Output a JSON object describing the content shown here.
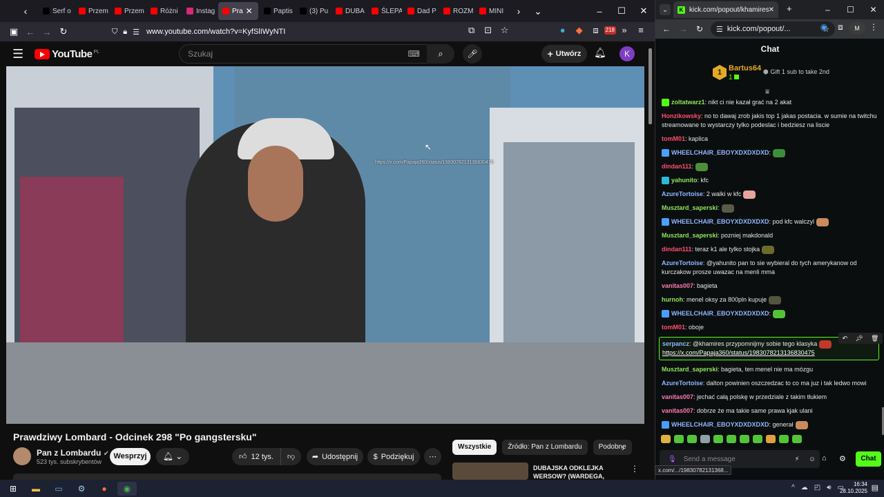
{
  "left_browser": {
    "tabs": [
      {
        "label": "Serf o",
        "color": "#000000",
        "icon": "x-logo-icon"
      },
      {
        "label": "Przem",
        "color": "#ff0000",
        "icon": "youtube-icon"
      },
      {
        "label": "Przem",
        "color": "#ff0000",
        "icon": "youtube-icon"
      },
      {
        "label": "Różni",
        "color": "#ff0000",
        "icon": "youtube-icon"
      },
      {
        "label": "Instag",
        "color": "#d62976",
        "icon": "instagram-icon"
      },
      {
        "label": "Pra",
        "color": "#ff0000",
        "icon": "speaker-icon",
        "active": true
      },
      {
        "label": "Paptis",
        "color": "#000000",
        "icon": "x-logo-icon"
      },
      {
        "label": "(3) Pu",
        "color": "#000000",
        "icon": "x-logo-icon"
      },
      {
        "label": "DUBA",
        "color": "#ff0000",
        "icon": "youtube-icon"
      },
      {
        "label": "ŚLEPA",
        "color": "#ff0000",
        "icon": "youtube-icon"
      },
      {
        "label": "Dad P",
        "color": "#ff0000",
        "icon": "youtube-icon"
      },
      {
        "label": "ROZM",
        "color": "#ff0000",
        "icon": "youtube-icon"
      },
      {
        "label": "MINI",
        "color": "#ff0000",
        "icon": "youtube-icon"
      }
    ],
    "url": "www.youtube.com/watch?v=KyfSlIWyNTI",
    "badge_count": "218"
  },
  "youtube": {
    "logo": "YouTube",
    "logo_region": "PL",
    "search_placeholder": "Szukaj",
    "create_label": "Utwórz",
    "avatar_letter": "K",
    "video_overlay_text": "https://x.com/Papaja360/status/1983078213136830475",
    "title": "Prawdziwy Lombard - Odcinek 298 \"Po gangstersku\"",
    "channel_name": "Pan z Lombardu",
    "subscribers": "523 tys. subskrybentów",
    "support_label": "Wesprzyj",
    "likes": "12 tys.",
    "share_label": "Udostępnij",
    "thanks_label": "Podziękuj",
    "chips": [
      "Wszystkie",
      "Źródło: Pan z Lombardu",
      "Podobne"
    ],
    "rec_title": "DUBAJSKA ODKLEJKA WERSOW? (WARDEGA, NITRO..."
  },
  "right_browser": {
    "tab_title": "kick.com/popout/khamires/cha",
    "url": "kick.com/popout/...",
    "profile_letter": "M"
  },
  "chat": {
    "header": "Chat",
    "pinned_user": "Bartus64",
    "pinned_count": "1",
    "pinned_rank": "1",
    "pinned_gift": "Gift 1 sub to take 2nd",
    "messages": [
      {
        "user": "zoltatwarz1",
        "color": "#8ee65c",
        "text": ": nikt ci nie kazał grać na 2 akat",
        "badge": "#53fc18"
      },
      {
        "user": "Honzikowsky",
        "color": "#ff4d6d",
        "text": ": no to dawaj zrob jakis top 1 jakas postacia. w sumie na twitchu streamowane to wystarczy tylko podeslac i bedziesz na liscie"
      },
      {
        "user": "tomM01",
        "color": "#ff4d6d",
        "text": ": kaplica"
      },
      {
        "user": "WHEELCHAIR_EBOYXDXDXDXD",
        "color": "#8fb8ff",
        "text": ":",
        "badge": "#4a9eff",
        "emote": "#3b8f3b"
      },
      {
        "user": "dindan111",
        "color": "#ff4d6d",
        "text": ":",
        "emote": "#4e8f3a"
      },
      {
        "user": "yahunito",
        "color": "#8ee65c",
        "text": ": kfc",
        "badge": "#2fb9d6"
      },
      {
        "user": "AzureTortoise",
        "color": "#8fb8ff",
        "text": ": 2 walki w kfc",
        "emote": "#e6a59c"
      },
      {
        "user": "Musztard_saperski",
        "color": "#8ee65c",
        "text": ":",
        "emote": "#5a5a48"
      },
      {
        "user": "WHEELCHAIR_EBOYXDXDXDXD",
        "color": "#8fb8ff",
        "text": ": pod kfc walczyl",
        "badge": "#4a9eff",
        "emote": "#c98a5c"
      },
      {
        "user": "Musztard_saperski",
        "color": "#8ee65c",
        "text": ": pozniej makdonald"
      },
      {
        "user": "dindan111",
        "color": "#ff4d6d",
        "text": ": teraz k1 ale tylko stojka",
        "emote": "#6b6b2a"
      },
      {
        "user": "AzureTortoise",
        "color": "#8fb8ff",
        "text": ": @yahunito pan to sie wybieral do tych amerykanow od kurczakow prosze uwazac na menli mma"
      },
      {
        "user": "vanitas007",
        "color": "#ff79b0",
        "text": ": bagieta"
      },
      {
        "user": "hurnoh",
        "color": "#8ee65c",
        "text": ": menel oksy za 800pln kupuje",
        "emote": "#55553f"
      },
      {
        "user": "WHEELCHAIR_EBOYXDXDXDXD",
        "color": "#8fb8ff",
        "text": ":",
        "badge": "#4a9eff",
        "emote": "#53c43a"
      },
      {
        "user": "tomM01",
        "color": "#ff4d6d",
        "text": ": oboje"
      },
      {
        "user": "serpancz",
        "color": "#8fb8ff",
        "text": ": @khamires przypomnijmy sobie tego klasyka",
        "link": "https://x.com/Papaja360/status/1983078213136830475",
        "highlight": true,
        "emote": "#c0392b"
      },
      {
        "user": "Musztard_saperski",
        "color": "#8ee65c",
        "text": ": bagieta, ten menel nie ma mózgu"
      },
      {
        "user": "AzureTortoise",
        "color": "#8fb8ff",
        "text": ": dalton powinien oszczedzac to co ma juz i tak ledwo mowi"
      },
      {
        "user": "vanitas007",
        "color": "#ff79b0",
        "text": ": jechać całą polskę w przedziale z takim tłukiem"
      },
      {
        "user": "vanitas007",
        "color": "#ff79b0",
        "text": ": dobrze że ma takie same prawa kjak ulani"
      },
      {
        "user": "WHEELCHAIR_EBOYXDXDXDXD",
        "color": "#8fb8ff",
        "text": ": generał",
        "badge": "#4a9eff",
        "emote": "#c98a5c"
      }
    ],
    "input_placeholder": "Send a message",
    "send_label": "Chat",
    "status_url": "x.com/.../19830782131368..."
  },
  "taskbar": {
    "time": "16:34",
    "date": "28.10.2025"
  }
}
